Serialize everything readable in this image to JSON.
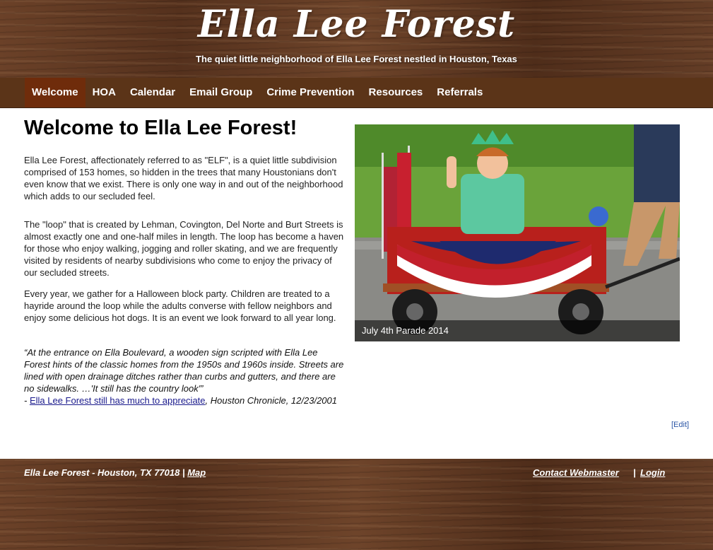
{
  "header": {
    "title": "Ella Lee Forest",
    "tagline": "The quiet little neighborhood of Ella Lee Forest nestled in Houston, Texas"
  },
  "nav": {
    "items": [
      "Welcome",
      "HOA",
      "Calendar",
      "Email Group",
      "Crime Prevention",
      "Resources",
      "Referrals"
    ],
    "active": "Welcome"
  },
  "main": {
    "heading": "Welcome to Ella Lee Forest!",
    "para1": "Ella Lee Forest, affectionately referred to as \"ELF\", is a quiet little subdivision comprised of 153 homes, so hidden in the trees that many Houstonians don't even know that we exist.  There is only one way in and out of the neighborhood which adds to our secluded feel.",
    "para2": "The \"loop\" that is created by Lehman, Covington, Del Norte and Burt Streets is almost exactly one and one-half miles in length. The loop has become a haven for those who enjoy walking, jogging and roller skating, and we are frequently visited by residents of nearby subdivisions who come to enjoy the privacy of our secluded streets.",
    "para3": "Every year, we gather for a Halloween block party.  Children are treated to a hayride around the loop while the adults converse with fellow neighbors and enjoy some delicious hot dogs.  It is an event we look forward to all year long.",
    "quote": "“At the entrance on Ella Boulevard, a wooden sign scripted with Ella Lee Forest hints of the classic homes from the 1950s and 1960s inside.  Streets are lined with open drainage ditches rather than curbs and gutters, and there are no sidewalks. …'It still has the country look'”",
    "quote_prefix": "- ",
    "quote_link": "Ella Lee Forest still has much to appreciate",
    "quote_source": ", Houston Chronicle, 12/23/2001",
    "photo_caption": "July 4th Parade 2014",
    "edit_label": "[Edit]"
  },
  "footer": {
    "address": "Ella Lee Forest - Houston, TX 77018 | ",
    "map_label": "Map",
    "contact_label": "Contact Webmaster",
    "separator": "|",
    "login_label": "Login"
  },
  "colors": {
    "nav_bg": "#5b3418",
    "nav_active": "#6f2c0b",
    "link": "#1a1a8c",
    "edit_link": "#2a55a5"
  }
}
